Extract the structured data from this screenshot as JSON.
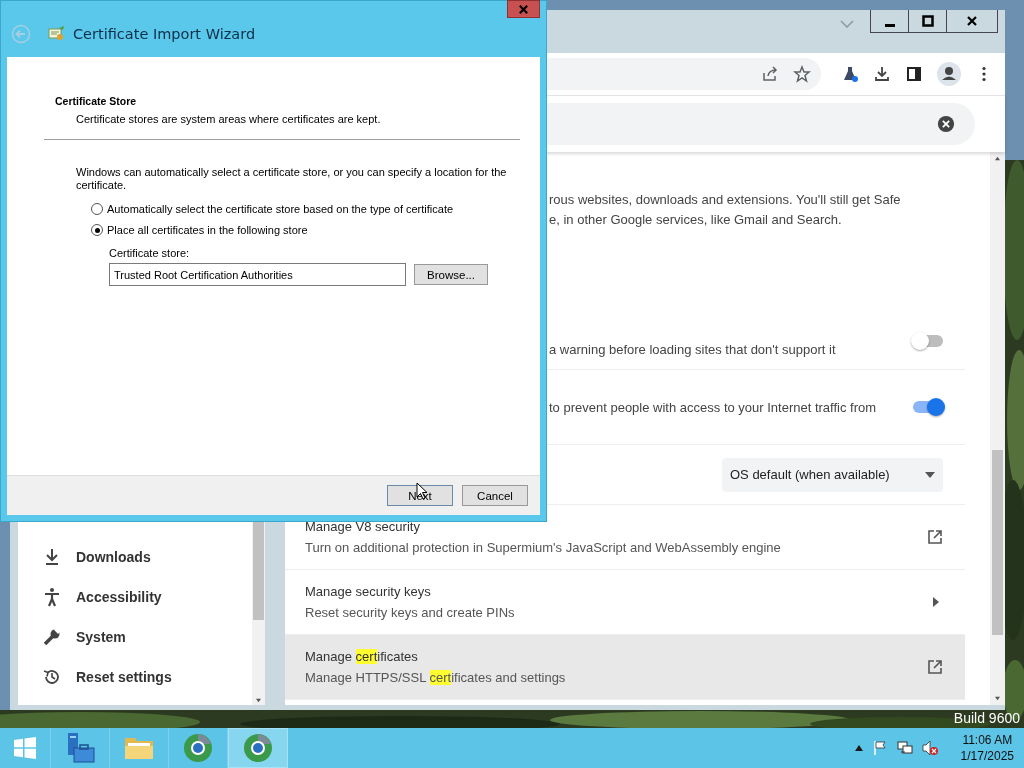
{
  "wizard": {
    "title": "Certificate Import Wizard",
    "heading": "Certificate Store",
    "subheading": "Certificate stores are system areas where certificates are kept.",
    "intro": "Windows can automatically select a certificate store, or you can specify a location for the certificate.",
    "options": [
      {
        "label": "Automatically select the certificate store based on the type of certificate",
        "selected": false
      },
      {
        "label": "Place all certificates in the following store",
        "selected": true
      }
    ],
    "store_label": "Certificate store:",
    "store_value": "Trusted Root Certification Authorities",
    "browse_button": "Browse...",
    "buttons": [
      {
        "label": "Next",
        "kind": "primary"
      },
      {
        "label": "Cancel",
        "kind": "secondary"
      }
    ]
  },
  "browser": {
    "sidebar": {
      "items": [
        {
          "label": "Downloads",
          "kind": "download"
        },
        {
          "label": "Accessibility",
          "kind": "accessibility"
        },
        {
          "label": "System",
          "kind": "wrench"
        },
        {
          "label": "Reset settings",
          "kind": "reset"
        }
      ]
    },
    "intro_lines": [
      "rous websites, downloads and extensions. You'll still get Safe",
      "e, in other Google services, like Gmail and Search."
    ],
    "toggles": [
      {
        "text": "a warning before loading sites that don't support it",
        "on": false
      },
      {
        "text": "to prevent people with access to your Internet traffic from",
        "on": true
      }
    ],
    "dropdown": {
      "value": "OS default (when available)"
    },
    "links": [
      {
        "kind": "external",
        "selected": false,
        "title_parts": [
          {
            "text": "Manage V8 security",
            "match": false
          }
        ],
        "description_parts": [
          {
            "text": "Turn on additional protection in Supermium's JavaScript and WebAssembly engine",
            "match": false
          }
        ]
      },
      {
        "kind": "subpage",
        "selected": false,
        "title_parts": [
          {
            "text": "Manage security keys",
            "match": false
          }
        ],
        "description_parts": [
          {
            "text": "Reset security keys and create PINs",
            "match": false
          }
        ]
      },
      {
        "kind": "external",
        "selected": true,
        "title_parts": [
          {
            "text": "Manage ",
            "match": false
          },
          {
            "text": "cert",
            "match": true
          },
          {
            "text": "ificates",
            "match": false
          }
        ],
        "description_parts": [
          {
            "text": "Manage HTTPS/SSL ",
            "match": false
          },
          {
            "text": "cert",
            "match": true
          },
          {
            "text": "ificates and settings",
            "match": false
          }
        ]
      }
    ]
  },
  "desktop": {
    "build_text": "Build 9600"
  },
  "taskbar": {
    "apps": [
      {
        "kind": "start",
        "selected": false
      },
      {
        "kind": "server-manager",
        "selected": false
      },
      {
        "kind": "folder",
        "selected": false
      },
      {
        "kind": "browser",
        "selected": false
      },
      {
        "kind": "browser",
        "selected": true
      }
    ],
    "time": "11:06 AM",
    "date": "1/17/2025"
  }
}
